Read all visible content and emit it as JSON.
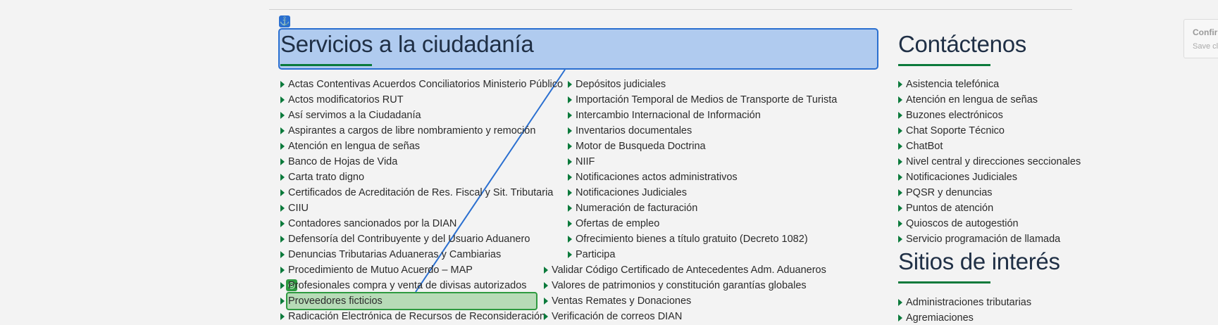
{
  "colors": {
    "accent": "#0b7a3b",
    "title": "#1f2f45",
    "highlight_blue": "#2a6fd0",
    "highlight_green": "#2e9a40"
  },
  "services": {
    "title": "Servicios a la ciudadanía",
    "col1": [
      "Actas Contentivas Acuerdos Conciliatorios Ministerio Público",
      "Actos modificatorios RUT",
      "Así servimos a la Ciudadanía",
      "Aspirantes a cargos de libre nombramiento y remoción",
      "Atención en lengua de señas",
      "Banco de Hojas de Vida",
      "Carta trato digno",
      "Certificados de Acreditación de Res. Fiscal y Sit. Tributaria",
      "CIIU",
      "Contadores sancionados por la DIAN",
      "Defensoría del Contribuyente y del Usuario Aduanero",
      "Denuncias Tributarias Aduaneras y Cambiarias",
      "Procedimiento de Mutuo Acuerdo – MAP",
      "Profesionales compra y venta de divisas autorizados",
      "Proveedores ficticios",
      "Radicación Electrónica de Recursos de Reconsideración"
    ],
    "col2a": [
      "Depósitos judiciales",
      "Importación Temporal de Medios de Transporte de Turista",
      "Intercambio Internacional de Información",
      "Inventarios documentales",
      "Motor de Busqueda Doctrina",
      "NIIF",
      "Notificaciones actos administrativos",
      "Notificaciones Judiciales",
      "Numeración de facturación",
      "Ofertas de empleo",
      "Ofrecimiento bienes a título gratuito (Decreto 1082)",
      "Participa"
    ],
    "col2b": [
      "Validar Código Certificado de Antecedentes Adm. Aduaneros",
      "Valores de patrimonios y constitución garantías globales",
      "Ventas Remates y Donaciones",
      "Verificación de correos DIAN"
    ]
  },
  "contact": {
    "title": "Contáctenos",
    "items": [
      "Asistencia telefónica",
      "Atención en lengua de señas",
      "Buzones electrónicos",
      "Chat Soporte Técnico",
      "ChatBot",
      "Nivel central y direcciones seccionales",
      "Notificaciones Judiciales",
      "PQSR y denuncias",
      "Puntos de atención",
      "Quioscos de autogestión",
      "Servicio programación de llamada"
    ]
  },
  "sites": {
    "title": "Sitios de interés",
    "items": [
      "Administraciones tributarias",
      "Agremiaciones"
    ]
  },
  "toast": {
    "title": "Confir",
    "subtitle": "Save cl"
  },
  "overlay": {
    "anchor_icon": "⚓",
    "target_icon": "◎"
  }
}
